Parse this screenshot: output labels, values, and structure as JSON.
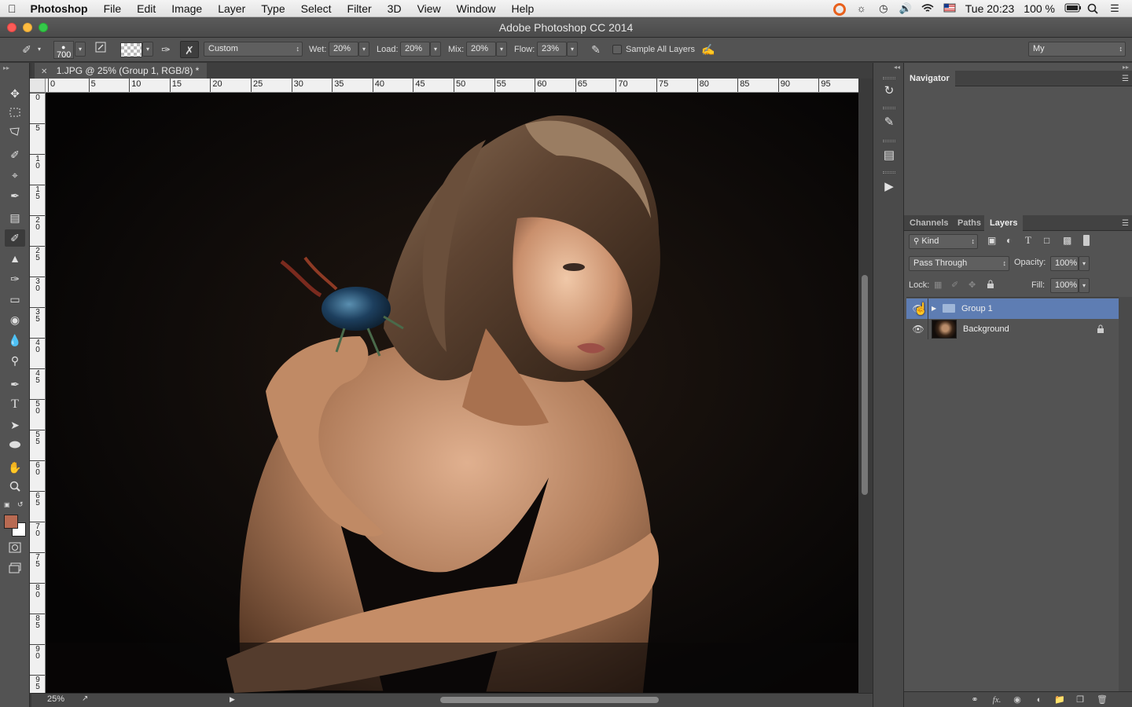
{
  "menubar": {
    "app": "Photoshop",
    "items": [
      "File",
      "Edit",
      "Image",
      "Layer",
      "Type",
      "Select",
      "Filter",
      "3D",
      "View",
      "Window",
      "Help"
    ],
    "clock": "Tue 20:23",
    "battery": "100 %"
  },
  "window": {
    "title": "Adobe Photoshop CC 2014"
  },
  "options": {
    "brush_size": "700",
    "preset": "Custom",
    "wet_label": "Wet:",
    "wet": "20%",
    "load_label": "Load:",
    "load": "20%",
    "mix_label": "Mix:",
    "mix": "20%",
    "flow_label": "Flow:",
    "flow": "23%",
    "sample_all_layers": "Sample All Layers",
    "workspace": "My"
  },
  "document": {
    "tab": "1.JPG @ 25% (Group 1, RGB/8) *",
    "zoom": "25%",
    "hruler": [
      "0",
      "5",
      "10",
      "15",
      "20",
      "25",
      "30",
      "35",
      "40",
      "45",
      "50",
      "55",
      "60",
      "65",
      "70",
      "75",
      "80",
      "85",
      "90",
      "95"
    ],
    "vruler": [
      "0",
      "5",
      "1 0",
      "1 5",
      "2 0",
      "2 5",
      "3 0",
      "3 5",
      "4 0",
      "4 5",
      "5 0",
      "5 5",
      "6 0",
      "6 5",
      "7 0",
      "7 5",
      "8 0",
      "8 5",
      "9 0",
      "9 5"
    ]
  },
  "navigator": {
    "title": "Navigator"
  },
  "layers_panel": {
    "tabs": [
      "Channels",
      "Paths",
      "Layers"
    ],
    "filter_kind": "Kind",
    "blend_mode": "Pass Through",
    "opacity_label": "Opacity:",
    "opacity": "100%",
    "lock_label": "Lock:",
    "fill_label": "Fill:",
    "fill": "100%",
    "layers": [
      {
        "name": "Group 1",
        "type": "group",
        "selected": true
      },
      {
        "name": "Background",
        "type": "image",
        "selected": false,
        "locked": true
      }
    ]
  },
  "colors": {
    "foreground": "#b86a52",
    "background": "#ffffff",
    "selection": "#5e7db3"
  }
}
